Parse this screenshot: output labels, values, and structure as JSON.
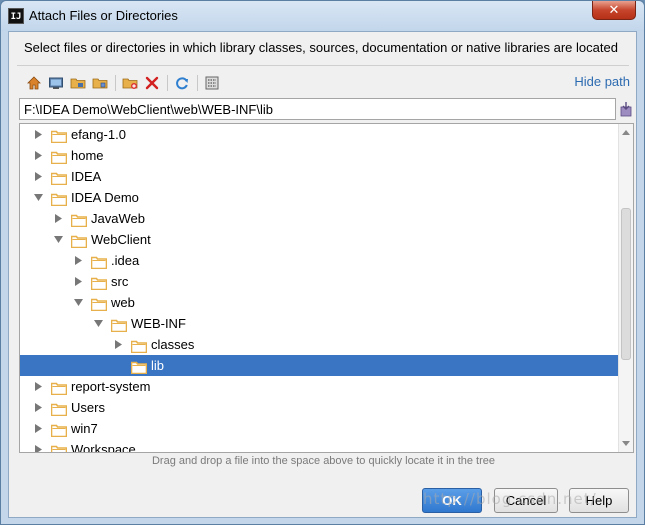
{
  "window": {
    "title": "Attach Files or Directories",
    "app_icon_text": "IJ",
    "close_glyph": "✕"
  },
  "description": "Select files or directories in which library classes, sources, documentation or native libraries are located",
  "toolbar": {
    "buttons": [
      {
        "name": "home-icon"
      },
      {
        "name": "desktop-icon"
      },
      {
        "name": "project-folder-icon"
      },
      {
        "name": "module-folder-icon"
      },
      {
        "name": "new-folder-icon"
      },
      {
        "name": "delete-icon"
      },
      {
        "name": "refresh-icon"
      },
      {
        "name": "show-hidden-icon"
      }
    ],
    "hide_path_label": "Hide path"
  },
  "path": {
    "value": "F:\\IDEA Demo\\WebClient\\web\\WEB-INF\\lib"
  },
  "tree": {
    "rows": [
      {
        "label": "efang-1.0",
        "depth": 1,
        "state": "collapsed",
        "selected": false
      },
      {
        "label": "home",
        "depth": 1,
        "state": "collapsed",
        "selected": false
      },
      {
        "label": "IDEA",
        "depth": 1,
        "state": "collapsed",
        "selected": false
      },
      {
        "label": "IDEA Demo",
        "depth": 1,
        "state": "expanded",
        "selected": false
      },
      {
        "label": "JavaWeb",
        "depth": 2,
        "state": "collapsed",
        "selected": false
      },
      {
        "label": "WebClient",
        "depth": 2,
        "state": "expanded",
        "selected": false
      },
      {
        "label": ".idea",
        "depth": 3,
        "state": "collapsed",
        "selected": false
      },
      {
        "label": "src",
        "depth": 3,
        "state": "collapsed",
        "selected": false
      },
      {
        "label": "web",
        "depth": 3,
        "state": "expanded",
        "selected": false
      },
      {
        "label": "WEB-INF",
        "depth": 4,
        "state": "expanded",
        "selected": false
      },
      {
        "label": "classes",
        "depth": 5,
        "state": "collapsed",
        "selected": false
      },
      {
        "label": "lib",
        "depth": 5,
        "state": "leaf",
        "selected": true
      },
      {
        "label": "report-system",
        "depth": 1,
        "state": "collapsed",
        "selected": false
      },
      {
        "label": "Users",
        "depth": 1,
        "state": "collapsed",
        "selected": false
      },
      {
        "label": "win7",
        "depth": 1,
        "state": "collapsed",
        "selected": false
      },
      {
        "label": "Workspace",
        "depth": 1,
        "state": "collapsed",
        "selected": false
      }
    ]
  },
  "hint": "Drag and drop a file into the space above to quickly locate it in the tree",
  "buttons": {
    "ok": "OK",
    "cancel": "Cancel",
    "help": "Help"
  },
  "colors": {
    "selection": "#3a75c4",
    "folder": "#e8b04a",
    "link": "#2d6bb1"
  },
  "watermark": "http://blog.csdn.net/"
}
